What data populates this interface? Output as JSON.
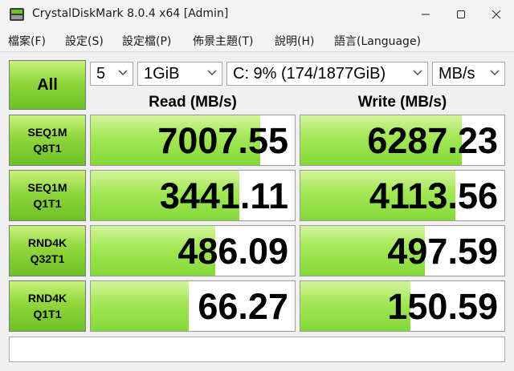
{
  "window": {
    "title": "CrystalDiskMark 8.0.4 x64 [Admin]"
  },
  "menu": {
    "items": [
      {
        "label": "檔案(F)"
      },
      {
        "label": "設定(S)"
      },
      {
        "label": "設定檔(P)"
      },
      {
        "label": "佈景主題(T)"
      },
      {
        "label": "說明(H)"
      },
      {
        "label": "語言(Language)"
      }
    ]
  },
  "controls": {
    "all_button": "All",
    "count": "5",
    "size": "1GiB",
    "drive": "C: 9% (174/1877GiB)",
    "unit": "MB/s"
  },
  "headers": {
    "read": "Read (MB/s)",
    "write": "Write (MB/s)"
  },
  "tests": [
    {
      "line1": "SEQ1M",
      "line2": "Q8T1",
      "read": "7007.55",
      "write": "6287.23",
      "read_fill": 0.83,
      "write_fill": 0.79
    },
    {
      "line1": "SEQ1M",
      "line2": "Q1T1",
      "read": "3441.11",
      "write": "4113.56",
      "read_fill": 0.73,
      "write_fill": 0.76
    },
    {
      "line1": "RND4K",
      "line2": "Q32T1",
      "read": "486.09",
      "write": "497.59",
      "read_fill": 0.61,
      "write_fill": 0.61
    },
    {
      "line1": "RND4K",
      "line2": "Q1T1",
      "read": "66.27",
      "write": "150.59",
      "read_fill": 0.48,
      "write_fill": 0.54
    }
  ],
  "comment": "",
  "colors": {
    "accent_green": "#8fd63c",
    "bar_green": "#a6e85a"
  }
}
